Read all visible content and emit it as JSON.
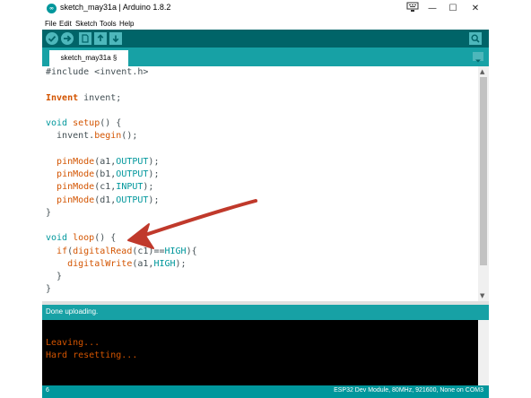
{
  "window": {
    "title": "sketch_may31a | Arduino 1.8.2",
    "app_icon_label": "∞"
  },
  "menu": [
    "File",
    "Edit",
    "Sketch",
    "Tools",
    "Help"
  ],
  "toolbar": {
    "buttons": [
      "verify-icon",
      "upload-icon",
      "new-icon",
      "open-icon",
      "save-icon"
    ],
    "serial_monitor": "serial-monitor-icon"
  },
  "tabs": [
    {
      "label": "sketch_may31a §"
    }
  ],
  "editor": {
    "lines": [
      [
        {
          "t": "#include <invent.h>",
          "c": "pl"
        }
      ],
      [],
      [
        {
          "t": "Invent",
          "c": "kw"
        },
        {
          "t": " invent;",
          "c": "pl"
        }
      ],
      [],
      [
        {
          "t": "void",
          "c": "kt"
        },
        {
          "t": " ",
          "c": "pl"
        },
        {
          "t": "setup",
          "c": "fn"
        },
        {
          "t": "() {",
          "c": "pl"
        }
      ],
      [
        {
          "t": "  invent.",
          "c": "pl"
        },
        {
          "t": "begin",
          "c": "fn"
        },
        {
          "t": "();",
          "c": "pl"
        }
      ],
      [],
      [
        {
          "t": "  ",
          "c": "pl"
        },
        {
          "t": "pinMode",
          "c": "fn"
        },
        {
          "t": "(a1,",
          "c": "pl"
        },
        {
          "t": "OUTPUT",
          "c": "kt"
        },
        {
          "t": ");",
          "c": "pl"
        }
      ],
      [
        {
          "t": "  ",
          "c": "pl"
        },
        {
          "t": "pinMode",
          "c": "fn"
        },
        {
          "t": "(b1,",
          "c": "pl"
        },
        {
          "t": "OUTPUT",
          "c": "kt"
        },
        {
          "t": ");",
          "c": "pl"
        }
      ],
      [
        {
          "t": "  ",
          "c": "pl"
        },
        {
          "t": "pinMode",
          "c": "fn"
        },
        {
          "t": "(c1,",
          "c": "pl"
        },
        {
          "t": "INPUT",
          "c": "kt"
        },
        {
          "t": ");",
          "c": "pl"
        }
      ],
      [
        {
          "t": "  ",
          "c": "pl"
        },
        {
          "t": "pinMode",
          "c": "fn"
        },
        {
          "t": "(d1,",
          "c": "pl"
        },
        {
          "t": "OUTPUT",
          "c": "kt"
        },
        {
          "t": ");",
          "c": "pl"
        }
      ],
      [
        {
          "t": "}",
          "c": "pl"
        }
      ],
      [],
      [
        {
          "t": "void",
          "c": "kt"
        },
        {
          "t": " ",
          "c": "pl"
        },
        {
          "t": "loop",
          "c": "fn"
        },
        {
          "t": "() {",
          "c": "pl"
        }
      ],
      [
        {
          "t": "  ",
          "c": "pl"
        },
        {
          "t": "if",
          "c": "fn"
        },
        {
          "t": "(",
          "c": "pl"
        },
        {
          "t": "digitalRead",
          "c": "fn"
        },
        {
          "t": "(c1)==",
          "c": "pl"
        },
        {
          "t": "HIGH",
          "c": "kt"
        },
        {
          "t": "){",
          "c": "pl"
        }
      ],
      [
        {
          "t": "    ",
          "c": "pl"
        },
        {
          "t": "digitalWrite",
          "c": "fn"
        },
        {
          "t": "(a1,",
          "c": "pl"
        },
        {
          "t": "HIGH",
          "c": "kt"
        },
        {
          "t": ");",
          "c": "pl"
        }
      ],
      [
        {
          "t": "  }",
          "c": "pl"
        }
      ],
      [
        {
          "t": "}",
          "c": "pl"
        }
      ]
    ]
  },
  "status": {
    "text": "Done uploading."
  },
  "console": {
    "lines": [
      "Leaving...",
      "Hard resetting..."
    ]
  },
  "bottom": {
    "line_number": "6",
    "board": "ESP32 Dev Module, 80MHz, 921600, None on COM3"
  },
  "colors": {
    "toolbar": "#006468",
    "tabbar": "#17a1a5",
    "annotation_arrow": "#c0392b"
  }
}
